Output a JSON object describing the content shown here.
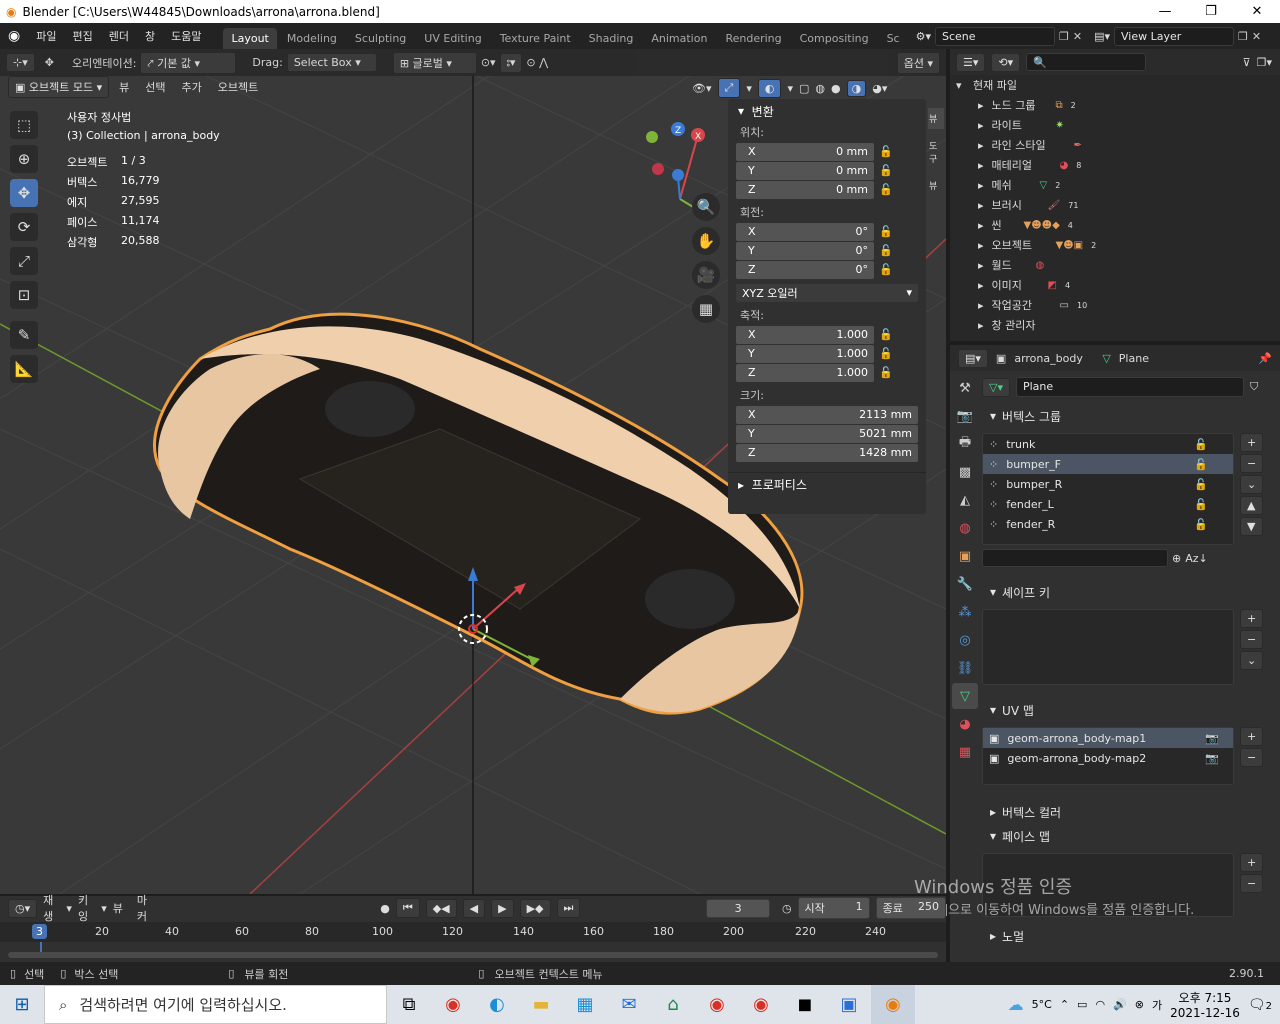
{
  "window": {
    "title": "Blender [C:\\Users\\W44845\\Downloads\\arrona\\arrona.blend]",
    "min": "—",
    "max": "❐",
    "close": "✕"
  },
  "menu": [
    "파일",
    "편집",
    "렌더",
    "창",
    "도움말"
  ],
  "workspaces": [
    "Layout",
    "Modeling",
    "Sculpting",
    "UV Editing",
    "Texture Paint",
    "Shading",
    "Animation",
    "Rendering",
    "Compositing",
    "Sc"
  ],
  "scene": "Scene",
  "view_layer": "View Layer",
  "viewport_header": {
    "orientation_label": "오리엔테이션:",
    "orientation_value": "기본 값",
    "drag_label": "Drag:",
    "drag_value": "Select Box",
    "transform": "글로벌",
    "options": "옵션"
  },
  "viewport_header2": {
    "mode": "오브젝트 모드",
    "view": "뷰",
    "select": "선택",
    "add": "추가",
    "object": "오브젝트"
  },
  "overlay_info": {
    "view_name": "사용자 정사법",
    "collection": "(3) Collection | arrona_body",
    "stats": [
      {
        "label": "오브젝트",
        "value": "1 / 3"
      },
      {
        "label": "버텍스",
        "value": "16,779"
      },
      {
        "label": "에지",
        "value": "27,595"
      },
      {
        "label": "페이스",
        "value": "11,174"
      },
      {
        "label": "삼각형",
        "value": "20,588"
      }
    ]
  },
  "npanel": {
    "transform_header": "변환",
    "location_label": "위치:",
    "location": [
      {
        "axis": "X",
        "value": "0 mm"
      },
      {
        "axis": "Y",
        "value": "0 mm"
      },
      {
        "axis": "Z",
        "value": "0 mm"
      }
    ],
    "rotation_label": "회전:",
    "rotation": [
      {
        "axis": "X",
        "value": "0°"
      },
      {
        "axis": "Y",
        "value": "0°"
      },
      {
        "axis": "Z",
        "value": "0°"
      }
    ],
    "rotation_mode": "XYZ 오일러",
    "scale_label": "축적:",
    "scale": [
      {
        "axis": "X",
        "value": "1.000"
      },
      {
        "axis": "Y",
        "value": "1.000"
      },
      {
        "axis": "Z",
        "value": "1.000"
      }
    ],
    "dimensions_label": "크기:",
    "dimensions": [
      {
        "axis": "X",
        "value": "2113 mm"
      },
      {
        "axis": "Y",
        "value": "5021 mm"
      },
      {
        "axis": "Z",
        "value": "1428 mm"
      }
    ],
    "properties_header": "프로퍼티스",
    "side_tabs": [
      "뷰",
      "도구",
      "뷰"
    ]
  },
  "outliner": {
    "root": "현재 파일",
    "items": [
      {
        "label": "노드 그룹",
        "badge": "2"
      },
      {
        "label": "라이트",
        "badge": ""
      },
      {
        "label": "라인 스타일",
        "badge": ""
      },
      {
        "label": "매테리얼",
        "badge": "8"
      },
      {
        "label": "메쉬",
        "badge": "2"
      },
      {
        "label": "브러시",
        "badge": "71"
      },
      {
        "label": "씬",
        "badge": "4"
      },
      {
        "label": "오브젝트",
        "badge": "2"
      },
      {
        "label": "월드",
        "badge": ""
      },
      {
        "label": "이미지",
        "badge": "4"
      },
      {
        "label": "작업공간",
        "badge": "10"
      },
      {
        "label": "창 관리자",
        "badge": ""
      }
    ]
  },
  "properties": {
    "object_name": "arrona_body",
    "mesh_name": "Plane",
    "data_name": "Plane",
    "vertex_groups_header": "버텍스 그룹",
    "vertex_groups": [
      "trunk",
      "bumper_F",
      "bumper_R",
      "fender_L",
      "fender_R"
    ],
    "selected_group": "bumper_F",
    "shape_keys_header": "셰이프 키",
    "uv_maps_header": "UV 맵",
    "uv_maps": [
      "geom-arrona_body-map1",
      "geom-arrona_body-map2"
    ],
    "vertex_colors_header": "버텍스 컬러",
    "face_maps_header": "페이스 맵",
    "normals_header": "노멀"
  },
  "watermark": {
    "line1": "Windows 정품 인증",
    "line2": "[설정]으로 이동하여 Windows를 정품 인증합니다."
  },
  "timeline": {
    "playback": "재생",
    "keying": "키잉",
    "view": "뷰",
    "marker": "마커",
    "current_frame": "3",
    "start_label": "시작",
    "start": "1",
    "end_label": "종료",
    "end": "250",
    "ruler": [
      "20",
      "40",
      "60",
      "80",
      "100",
      "120",
      "140",
      "160",
      "180",
      "200",
      "220",
      "240"
    ],
    "cursor": "3"
  },
  "statusbar": {
    "select": "선택",
    "box_select": "박스 선택",
    "rotate_view": "뷰를 회전",
    "context_menu": "오브젝트 컨텍스트 메뉴",
    "version": "2.90.1"
  },
  "taskbar": {
    "search_placeholder": "검색하려면 여기에 입력하십시오.",
    "weather": "5°C",
    "time": "오후 7:15",
    "date": "2021-12-16",
    "notifications": "2"
  },
  "colors": {
    "accent": "#4772b3",
    "selection_outline": "#f0a040",
    "viewport_bg": "#393939",
    "body_color": "#f0cfac"
  }
}
